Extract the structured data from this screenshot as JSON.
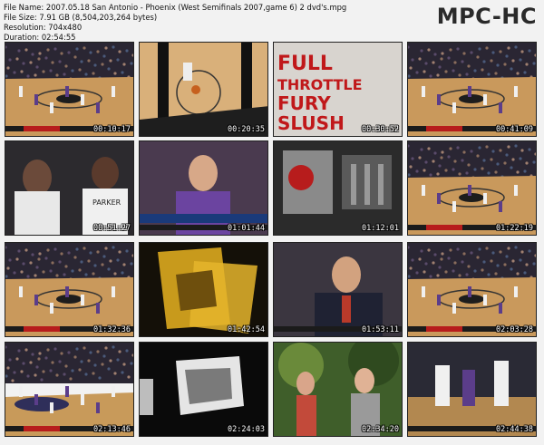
{
  "header": {
    "file_name": "File Name: 2007.05.18 San Antonio - Phoenix (West Semifinals 2007,game 6) 2 dvd's.mpg",
    "file_size": "File Size: 7.91 GB (8,504,203,264 bytes)",
    "resolution": "Resolution: 704x480",
    "duration": "Duration: 02:54:55"
  },
  "brand": "MPC-HC",
  "thumbnails": [
    {
      "time": "00:10:17",
      "scene": "court"
    },
    {
      "time": "00:20:35",
      "scene": "overhead"
    },
    {
      "time": "00:30:52",
      "scene": "ad-red"
    },
    {
      "time": "00:41:09",
      "scene": "court"
    },
    {
      "time": "00:51:27",
      "scene": "players"
    },
    {
      "time": "01:01:44",
      "scene": "player-close"
    },
    {
      "time": "01:12:01",
      "scene": "gears"
    },
    {
      "time": "01:22:19",
      "scene": "court-wide"
    },
    {
      "time": "01:32:36",
      "scene": "court"
    },
    {
      "time": "01:42:54",
      "scene": "gold"
    },
    {
      "time": "01:53:11",
      "scene": "coach"
    },
    {
      "time": "02:03:28",
      "scene": "court"
    },
    {
      "time": "02:13:46",
      "scene": "court-low"
    },
    {
      "time": "02:24:03",
      "scene": "dark-abstract"
    },
    {
      "time": "02:34:20",
      "scene": "outdoor"
    },
    {
      "time": "02:44:38",
      "scene": "players-action"
    }
  ]
}
